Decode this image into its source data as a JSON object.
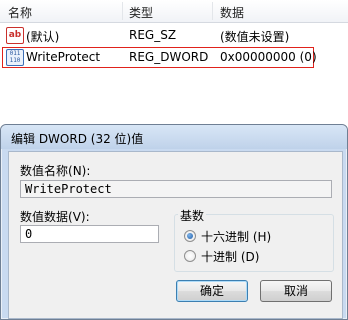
{
  "registry": {
    "columns": [
      "名称",
      "类型",
      "数据"
    ],
    "rows": [
      {
        "icon": "string-value-icon",
        "icon_text": "ab",
        "name": "(默认)",
        "type": "REG_SZ",
        "data": "(数值未设置)"
      },
      {
        "icon": "binary-value-icon",
        "icon_text": "011 110",
        "name": "WriteProtect",
        "type": "REG_DWORD",
        "data": "0x00000000 (0)"
      }
    ]
  },
  "dialog": {
    "title": "编辑 DWORD (32 位)值",
    "value_name_label": "数值名称",
    "value_name_key": "(N):",
    "value_name": "WriteProtect",
    "value_data_label": "数值数据",
    "value_data_key": "(V):",
    "value_data": "0",
    "base_label": "基数",
    "hex_label": "十六进制",
    "hex_key": "(H)",
    "dec_label": "十进制",
    "dec_key": "(D)",
    "selected_base": "hex",
    "ok_label": "确定",
    "cancel_label": "取消"
  },
  "colors": {
    "selection_outline": "#e0221b",
    "dialog_frame": "#c9daf0"
  }
}
